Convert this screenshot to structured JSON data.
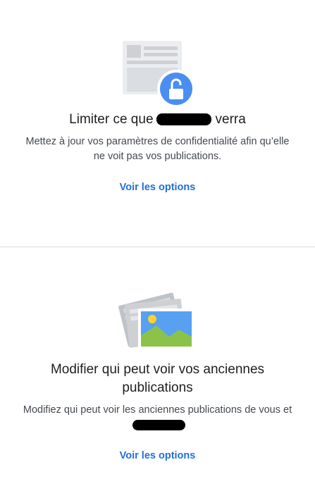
{
  "restrict_card": {
    "title_prefix": "Limiter ce que",
    "title_suffix": "verra",
    "description": "Mettez à jour vos paramètres de confidentialité afin qu’elle ne voit pas vos publications.",
    "action_label": "Voir les options",
    "illustration_icon": "profile-lock-icon"
  },
  "past_posts_card": {
    "title": "Modifier qui peut voir vos anciennes publications",
    "description_prefix": "Modifiez qui peut voir les anciennes publications de vous et",
    "action_label": "Voir les options",
    "illustration_icon": "photos-icon"
  },
  "colors": {
    "link": "#216fdb",
    "lock_badge": "#4a8ef0",
    "divider": "#dadde1",
    "photo_sky": "#57a0f2",
    "photo_hill": "#8bc34a",
    "photo_sun": "#ffd32a"
  }
}
